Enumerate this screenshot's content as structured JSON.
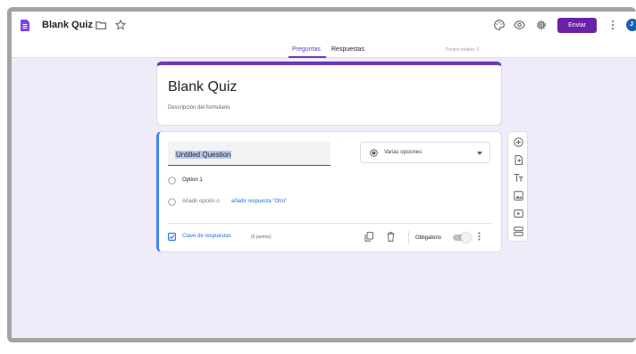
{
  "header": {
    "doc_title": "Blank Quiz",
    "send_label": "Enviar",
    "avatar_initial": "J",
    "icons": [
      "forms-app-icon",
      "folder-icon",
      "star-icon",
      "palette-icon",
      "preview-icon",
      "gear-icon",
      "more-vert-icon"
    ]
  },
  "tabs": [
    {
      "label": "Preguntas",
      "active": true
    },
    {
      "label": "Respuestas",
      "active": false
    }
  ],
  "total_points": "Puntos totales: 0",
  "form": {
    "title": "Blank Quiz",
    "description": "Descripción del formulario"
  },
  "question": {
    "title": "Untitled Question",
    "type": "Varias opciones",
    "options": [
      "Option 1"
    ],
    "add_option": "Añadir opción",
    "or": "o",
    "add_other": "añadir respuesta \"Otro\"",
    "answer_key": "Clave de respuestas",
    "points": "(0 puntos)",
    "required_label": "Obligatorio",
    "required": false
  },
  "side_toolbar": [
    "add-question-icon",
    "import-icon",
    "title-text-icon",
    "image-icon",
    "video-icon",
    "section-icon"
  ],
  "colors": {
    "accent": "#673ab7",
    "send_button": "#6a21a8",
    "background": "#f0ebf8",
    "link": "#1a73e8",
    "active_question": "#4285f4"
  }
}
